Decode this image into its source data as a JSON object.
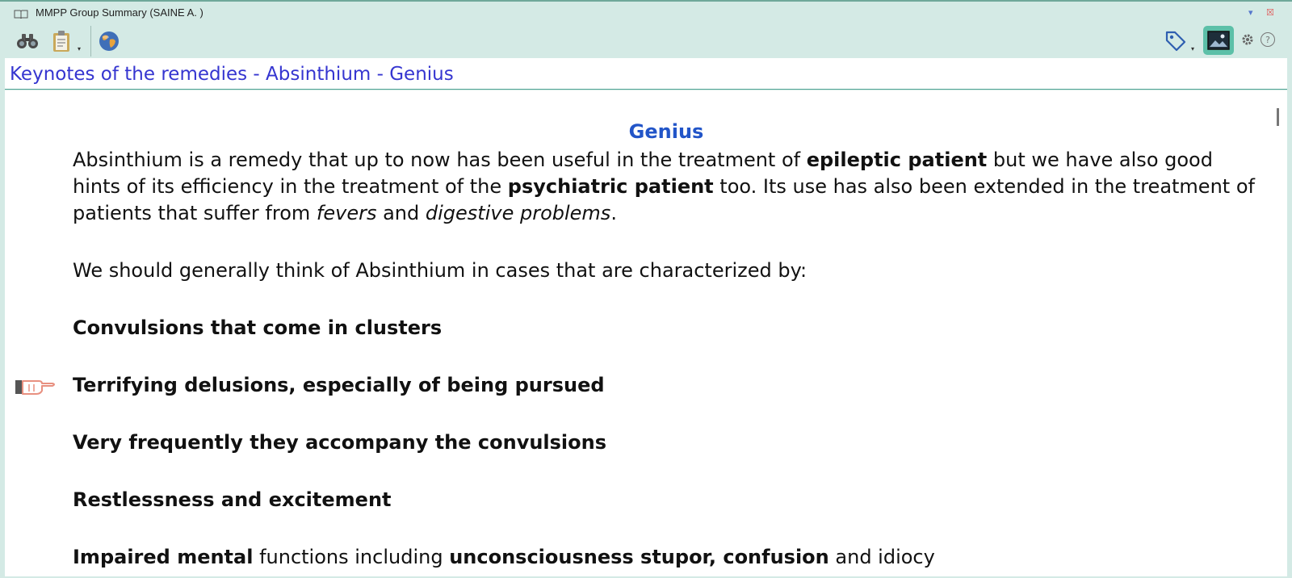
{
  "window": {
    "title": "MMPP Group Summary (SAINE A. )",
    "icons": {
      "book": "book-icon",
      "minimize": "minimize-icon",
      "close": "close-icon"
    },
    "controls": {
      "minimize": "▾",
      "close": "☒"
    }
  },
  "toolbar": {
    "left_icons": [
      "binoculars-icon",
      "clipboard-icon",
      "globe-icon"
    ],
    "right_icons": [
      "tag-icon",
      "image-toggle-icon",
      "settings-icon",
      "help-icon"
    ],
    "help_glyph": "?",
    "dropdown_glyph": "▾"
  },
  "header": {
    "title": "Keynotes of the remedies - Absinthium - Genius"
  },
  "document": {
    "heading": "Genius",
    "intro": {
      "t1": "Absinthium is a remedy that up to now has been useful in the treatment of ",
      "b1": "epileptic patient",
      "t2": " but we have also good hints of its efficiency in the treatment of the ",
      "b2": "psychiatric patient",
      "t3": " too. Its use has also been extended in the treatment of patients that suffer from ",
      "i1": "fevers",
      "t4": " and ",
      "i2": "digestive problems",
      "t5": "."
    },
    "lead": "We should generally think of Absinthium in cases that are characterized by:",
    "keynotes": [
      "Convulsions that come in clusters",
      "Terrifying delusions, especially of being pursued",
      "Very frequently they accompany the convulsions",
      "Restlessness and excitement"
    ],
    "last_line": {
      "b1": "Impaired mental",
      "t1": " functions including ",
      "b2": "unconsciousness stupor, confusion",
      "t2": " and idiocy"
    }
  },
  "colors": {
    "window_bg": "#d4eae5",
    "header_text": "#3535d0",
    "heading_text": "#2255c8",
    "accent_border": "#4fa394",
    "active_toggle": "#5cc0a8"
  }
}
